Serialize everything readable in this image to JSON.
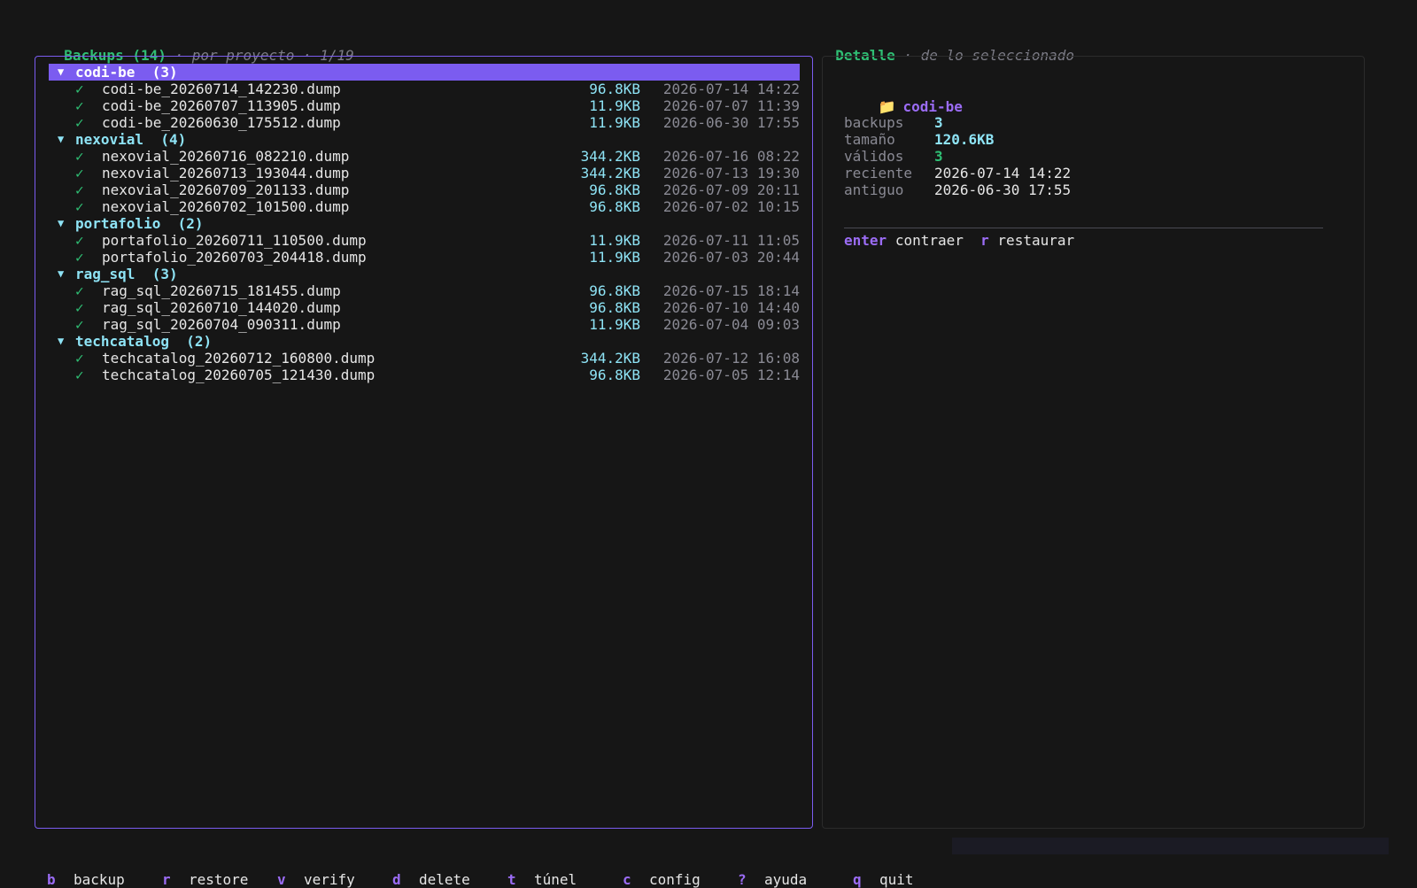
{
  "left_header": {
    "title": "Backups (14)",
    "subtitle": " · por proyecto · 1/19"
  },
  "right_header": {
    "title": "Detalle",
    "subtitle": " · de lo seleccionado"
  },
  "tree": [
    {
      "name": "codi-be",
      "count": "(3)",
      "arrow": "▼",
      "selected": true,
      "files": [
        {
          "check": "✓",
          "name": "codi-be_20260714_142230.dump",
          "size": "96.8KB",
          "date": "2026-07-14 14:22"
        },
        {
          "check": "✓",
          "name": "codi-be_20260707_113905.dump",
          "size": "11.9KB",
          "date": "2026-07-07 11:39"
        },
        {
          "check": "✓",
          "name": "codi-be_20260630_175512.dump",
          "size": "11.9KB",
          "date": "2026-06-30 17:55"
        }
      ]
    },
    {
      "name": "nexovial",
      "count": "(4)",
      "arrow": "▼",
      "selected": false,
      "files": [
        {
          "check": "✓",
          "name": "nexovial_20260716_082210.dump",
          "size": "344.2KB",
          "date": "2026-07-16 08:22"
        },
        {
          "check": "✓",
          "name": "nexovial_20260713_193044.dump",
          "size": "344.2KB",
          "date": "2026-07-13 19:30"
        },
        {
          "check": "✓",
          "name": "nexovial_20260709_201133.dump",
          "size": "96.8KB",
          "date": "2026-07-09 20:11"
        },
        {
          "check": "✓",
          "name": "nexovial_20260702_101500.dump",
          "size": "96.8KB",
          "date": "2026-07-02 10:15"
        }
      ]
    },
    {
      "name": "portafolio",
      "count": "(2)",
      "arrow": "▼",
      "selected": false,
      "files": [
        {
          "check": "✓",
          "name": "portafolio_20260711_110500.dump",
          "size": "11.9KB",
          "date": "2026-07-11 11:05"
        },
        {
          "check": "✓",
          "name": "portafolio_20260703_204418.dump",
          "size": "11.9KB",
          "date": "2026-07-03 20:44"
        }
      ]
    },
    {
      "name": "rag_sql",
      "count": "(3)",
      "arrow": "▼",
      "selected": false,
      "files": [
        {
          "check": "✓",
          "name": "rag_sql_20260715_181455.dump",
          "size": "96.8KB",
          "date": "2026-07-15 18:14"
        },
        {
          "check": "✓",
          "name": "rag_sql_20260710_144020.dump",
          "size": "96.8KB",
          "date": "2026-07-10 14:40"
        },
        {
          "check": "✓",
          "name": "rag_sql_20260704_090311.dump",
          "size": "11.9KB",
          "date": "2026-07-04 09:03"
        }
      ]
    },
    {
      "name": "techcatalog",
      "count": "(2)",
      "arrow": "▼",
      "selected": false,
      "files": [
        {
          "check": "✓",
          "name": "techcatalog_20260712_160800.dump",
          "size": "344.2KB",
          "date": "2026-07-12 16:08"
        },
        {
          "check": "✓",
          "name": "techcatalog_20260705_121430.dump",
          "size": "96.8KB",
          "date": "2026-07-05 12:14"
        }
      ]
    }
  ],
  "detail": {
    "folder_icon": "folder-icon",
    "folder_glyph": "📁",
    "name": "codi-be",
    "fields": [
      {
        "key": "backups",
        "value": "3",
        "style": "cyan"
      },
      {
        "key": "tamaño",
        "value": "120.6KB",
        "style": "cyan"
      },
      {
        "key": "válidos",
        "value": "3",
        "style": "green"
      },
      {
        "key": "reciente",
        "value": "2026-07-14 14:22",
        "style": ""
      },
      {
        "key": "antiguo",
        "value": "2026-06-30 17:55",
        "style": ""
      }
    ],
    "hints": [
      {
        "key": "enter",
        "label": "contraer"
      },
      {
        "key": "r",
        "label": "restaurar"
      }
    ]
  },
  "footer": [
    {
      "key": "b",
      "label": "backup"
    },
    {
      "key": "r",
      "label": "restore"
    },
    {
      "key": "v",
      "label": "verify"
    },
    {
      "key": "d",
      "label": "delete"
    },
    {
      "key": "t",
      "label": "túnel"
    },
    {
      "key": "c",
      "label": "config"
    },
    {
      "key": "?",
      "label": "ayuda"
    },
    {
      "key": "q",
      "label": "quit"
    }
  ],
  "colors": {
    "accent": "#7b5cf0",
    "title_green": "#2fbf74",
    "cyan": "#8ee3f5",
    "background": "#161616"
  }
}
